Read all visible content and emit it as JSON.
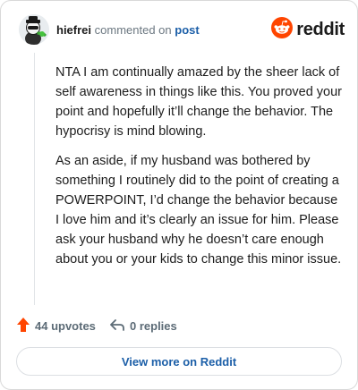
{
  "header": {
    "username": "hiefrei",
    "action_text": "commented on",
    "post_link": "post",
    "brand_word": "reddit"
  },
  "icons": {
    "avatar": "snoo-avatar-icon",
    "brand": "reddit-logo-icon",
    "upvote": "upvote-arrow-icon",
    "reply": "reply-arrow-icon"
  },
  "comment": {
    "paragraphs": [
      "NTA I am continually amazed by the sheer lack of self awareness in things like this. You proved your point and hopefully it’ll change the behavior. The hypocrisy is mind blowing.",
      "As an aside, if my husband was bothered by something I routinely did to the point of creating a POWERPOINT, I’d change the behavior because I love him and it’s clearly an issue for him. Please ask your husband why he doesn’t care enough about you or your kids to change this minor issue."
    ]
  },
  "actions": {
    "upvotes": "44 upvotes",
    "replies": "0 replies"
  },
  "footer": {
    "view_more": "View more on Reddit"
  },
  "colors": {
    "reddit_orange": "#ff4500",
    "link_blue": "#1c5fa8"
  }
}
